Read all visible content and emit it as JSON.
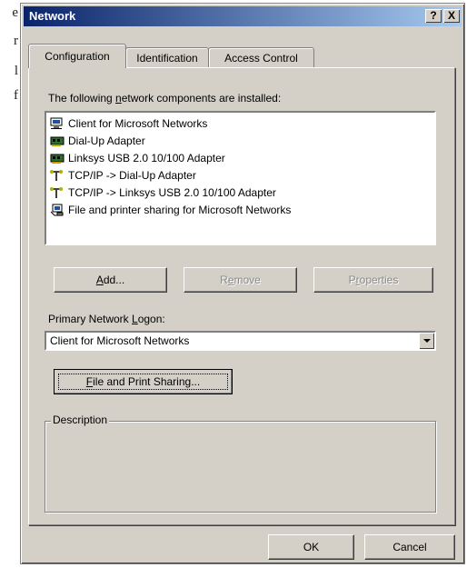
{
  "background_text": [
    "e",
    "r",
    "l",
    "f"
  ],
  "window": {
    "title": "Network",
    "help_button": "?",
    "close_button": "X"
  },
  "tabs": [
    {
      "label": "Configuration",
      "active": true
    },
    {
      "label": "Identification",
      "active": false
    },
    {
      "label": "Access Control",
      "active": false
    }
  ],
  "components": {
    "label_pre": "The following ",
    "label_ul": "n",
    "label_post": "etwork components are installed:",
    "items": [
      {
        "label": "Client for Microsoft Networks",
        "icon": "network-client-icon"
      },
      {
        "label": "Dial-Up Adapter",
        "icon": "adapter-icon"
      },
      {
        "label": "Linksys USB 2.0 10/100 Adapter",
        "icon": "adapter-icon"
      },
      {
        "label": "TCP/IP -> Dial-Up Adapter",
        "icon": "protocol-icon"
      },
      {
        "label": "TCP/IP -> Linksys USB 2.0 10/100 Adapter",
        "icon": "protocol-icon"
      },
      {
        "label": "File and printer sharing for Microsoft Networks",
        "icon": "file-sharing-icon"
      }
    ]
  },
  "buttons": {
    "add_ul": "A",
    "add_rest": "dd...",
    "remove_pre": "R",
    "remove_ul": "e",
    "remove_rest": "move",
    "properties_pre": "P",
    "properties_ul": "r",
    "properties_rest": "operties"
  },
  "logon": {
    "label_pre": "Primary Network ",
    "label_ul": "L",
    "label_post": "ogon:",
    "value": "Client for Microsoft Networks"
  },
  "file_print": {
    "ul": "F",
    "rest": "ile and Print Sharing..."
  },
  "description": {
    "legend": "Description"
  },
  "footer": {
    "ok": "OK",
    "cancel": "Cancel"
  }
}
